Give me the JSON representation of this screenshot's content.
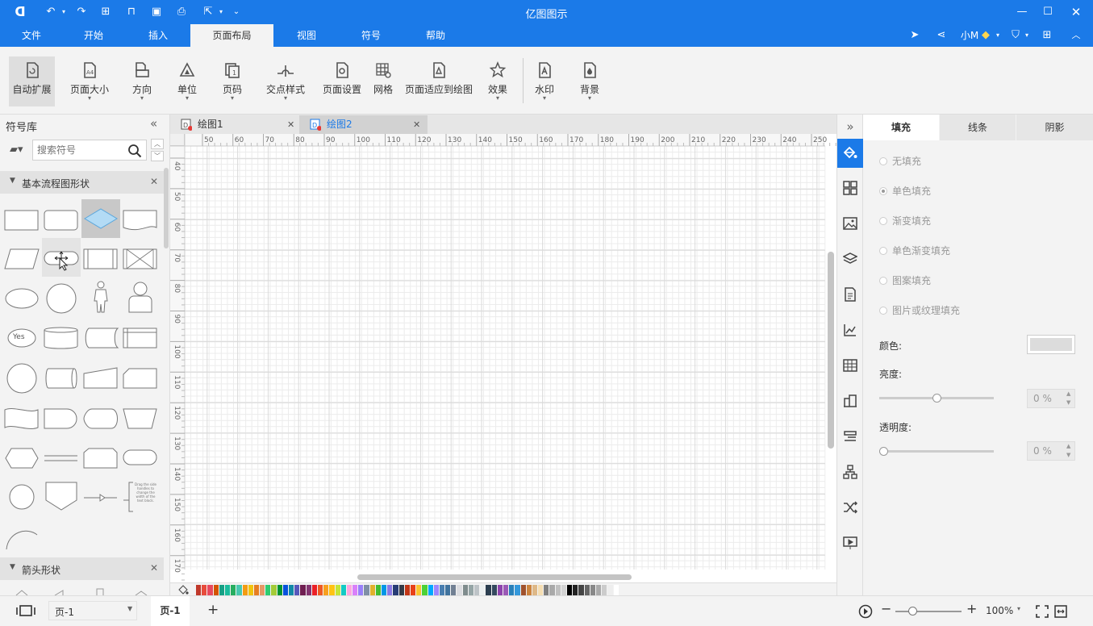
{
  "app": {
    "title": "亿图图示"
  },
  "menu": {
    "tabs": [
      "文件",
      "开始",
      "插入",
      "页面布局",
      "视图",
      "符号",
      "帮助"
    ],
    "active": "页面布局",
    "user": "小M"
  },
  "ribbon": {
    "buttons": [
      {
        "label": "自动扩展",
        "icon": "auto-expand-icon"
      },
      {
        "label": "页面大小",
        "icon": "page-size-icon",
        "badge": "A4"
      },
      {
        "label": "方向",
        "icon": "orientation-icon"
      },
      {
        "label": "单位",
        "icon": "unit-icon"
      },
      {
        "label": "页码",
        "icon": "page-number-icon",
        "badge": "1"
      },
      {
        "label": "交点样式",
        "icon": "jump-style-icon"
      },
      {
        "label": "页面设置",
        "icon": "page-setup-icon"
      },
      {
        "label": "网格",
        "icon": "grid-icon"
      },
      {
        "label": "页面适应到绘图",
        "icon": "fit-to-drawing-icon"
      },
      {
        "label": "效果",
        "icon": "effects-icon"
      },
      {
        "label": "水印",
        "icon": "watermark-icon"
      },
      {
        "label": "背景",
        "icon": "background-icon"
      }
    ]
  },
  "library": {
    "title": "符号库",
    "search_placeholder": "搜索符号",
    "sections": [
      {
        "title": "基本流程图形状"
      },
      {
        "title": "箭头形状"
      }
    ],
    "yes_label": "Yes",
    "note_text": "Drag the side handles to change the width of the text block."
  },
  "documents": {
    "tabs": [
      {
        "label": "绘图1",
        "active": false
      },
      {
        "label": "绘图2",
        "active": true
      }
    ]
  },
  "ruler": {
    "top": [
      "50",
      "60",
      "70",
      "80",
      "90",
      "100",
      "110",
      "120",
      "130",
      "140",
      "150",
      "160",
      "170",
      "180",
      "190",
      "200",
      "210",
      "220",
      "230",
      "240",
      "250"
    ],
    "left": [
      "40",
      "50",
      "60",
      "70",
      "80",
      "90",
      "100",
      "110",
      "120",
      "130",
      "140",
      "150",
      "160",
      "170"
    ]
  },
  "format_panel": {
    "tabs": [
      "填充",
      "线条",
      "阴影"
    ],
    "active_tab": "填充",
    "fill_options": [
      {
        "label": "无填充",
        "selected": false
      },
      {
        "label": "单色填充",
        "selected": true
      },
      {
        "label": "渐变填充",
        "selected": false
      },
      {
        "label": "单色渐变填充",
        "selected": false
      },
      {
        "label": "图案填充",
        "selected": false
      },
      {
        "label": "图片或纹理填充",
        "selected": false
      }
    ],
    "color_label": "颜色:",
    "brightness_label": "亮度:",
    "brightness_value": "0 %",
    "brightness_level": 0.5,
    "transparency_label": "透明度:",
    "transparency_value": "0 %",
    "transparency_level": 0
  },
  "status": {
    "page_select": "页-1",
    "page_tab": "页-1",
    "zoom": "100%"
  },
  "palette": [
    "#c0392b",
    "#e74c3c",
    "#e84a5f",
    "#d35400",
    "#16a085",
    "#1abc9c",
    "#27ae60",
    "#48c9b0",
    "#f39c12",
    "#f1c40f",
    "#e67e22",
    "#e59866",
    "#2ecc71",
    "#a3cb38",
    "#009432",
    "#0652dd",
    "#1289a7",
    "#5758bb",
    "#6f1e51",
    "#833471",
    "#ea2027",
    "#ee5a24",
    "#f79f1f",
    "#ffc312",
    "#c4e538",
    "#12cbc4",
    "#fda7df",
    "#d980fa",
    "#9980fa",
    "#7f8fa6",
    "#e1b12c",
    "#44bd32",
    "#0097e6",
    "#8c7ae6",
    "#273c75",
    "#353b48",
    "#c23616",
    "#e84118",
    "#fbc531",
    "#4cd137",
    "#00a8ff",
    "#9c88ff",
    "#487eb0",
    "#40739e",
    "#718093",
    "#dcdde1",
    "#7f8c8d",
    "#95a5a6",
    "#bdc3c7",
    "#ecf0f1",
    "#2c3e50",
    "#34495e",
    "#8e44ad",
    "#9b59b6",
    "#2980b9",
    "#3498db",
    "#a0522d",
    "#cd853f",
    "#deb887",
    "#f5deb3",
    "#808080",
    "#a9a9a9",
    "#c0c0c0",
    "#d3d3d3",
    "#000000",
    "#222222",
    "#444444",
    "#666666",
    "#888888",
    "#aaaaaa",
    "#cccccc",
    "#eeeeee",
    "#ffffff"
  ]
}
